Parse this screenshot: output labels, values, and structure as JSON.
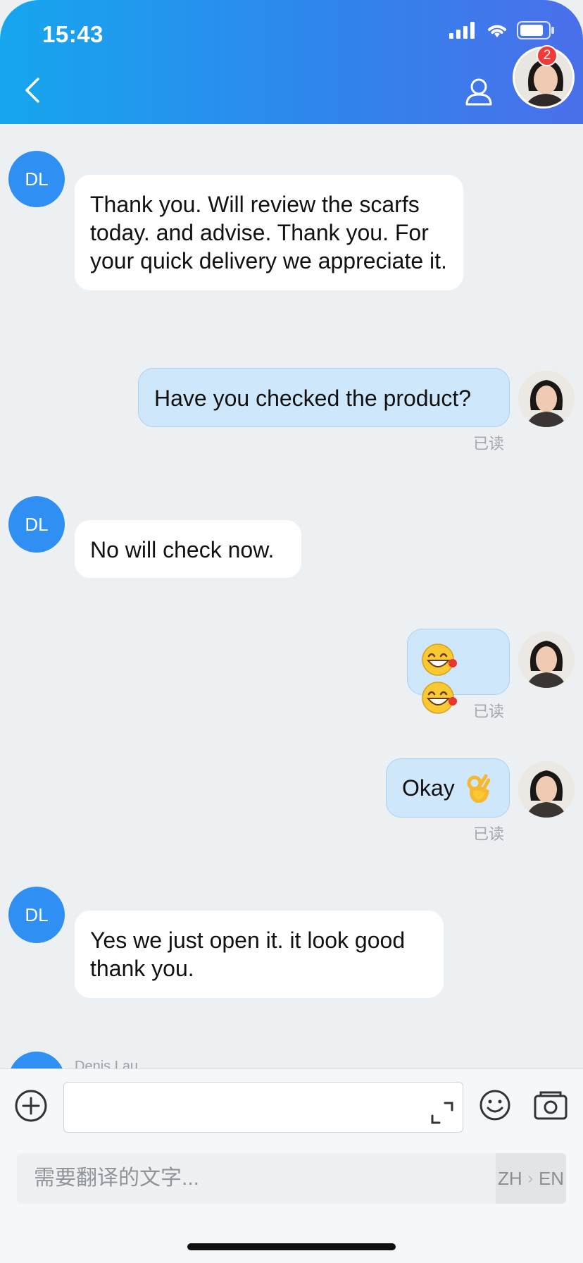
{
  "status_bar": {
    "time": "15:43"
  },
  "header": {
    "badge_count": "2"
  },
  "messages": [
    {
      "initials": "DL",
      "text": "Thank you. Will review the scarfs today. and advise. Thank you. For your quick delivery we appreciate it."
    },
    {
      "text": "Have you checked the product?",
      "read_label": "已读"
    },
    {
      "initials": "DL",
      "text": "No will check now."
    },
    {
      "emoji": "laughing-face-icon x2",
      "read_label": "已读"
    },
    {
      "text": "Okay",
      "emoji": "ok-hand-icon",
      "read_label": "已读"
    },
    {
      "initials": "DL",
      "text": "Yes we just open it. it look good thank you."
    },
    {
      "initials": "DL",
      "sender_name": "Denis Lau"
    }
  ],
  "input_bar": {
    "placeholder": ""
  },
  "translate_bar": {
    "placeholder": "需要翻译的文字...",
    "source_lang": "ZH",
    "target_lang": "EN"
  },
  "colors": {
    "header_start": "#16a6ee",
    "header_end": "#4a6fea",
    "avatar_blue": "#2f8ff3",
    "outgoing_bubble": "#cfe7fb"
  }
}
